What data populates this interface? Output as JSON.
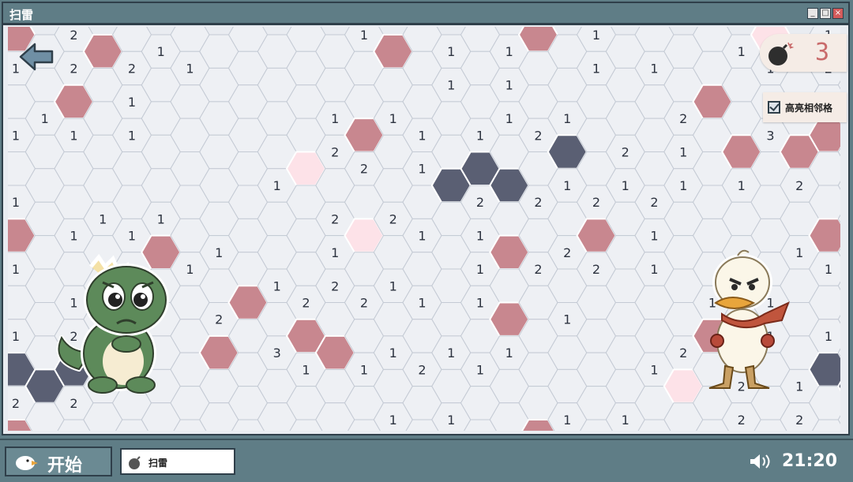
{
  "window": {
    "title": "扫雷"
  },
  "hud": {
    "mines_remaining": "3",
    "highlight_label": "高亮相邻格",
    "highlight_checked": true
  },
  "taskbar": {
    "start_label": "开始",
    "task_label": "扫雷",
    "clock": "21:20"
  },
  "icons": {
    "back": "back-arrow-icon",
    "bomb": "bomb-icon",
    "sound": "speaker-icon",
    "start": "duck-logo-icon"
  },
  "colors": {
    "hidden": "#eef0f4",
    "hidden_stroke": "#c4cad4",
    "mine": "#c8878f",
    "flag_light": "#fde2e8",
    "dark": "#5a5f73",
    "text": "#2d3340",
    "accent": "#c96b6b"
  },
  "board": {
    "rows": [
      "FN2MN1NNNNNN1MN1N1MN1NNNN1LN1N1MN2MN1NNN",
      "1N2N2N1NNNNNNNN1N1NN1N1NNN1N2N1NNN1N2N2N1NNN",
      "N1MN1NNNNNN1N1NNN1N1NNN2MN2N2N1N1MN1NNNN",
      "1N1N1NNNNNN2MN1N1N2DN2N1NM3MMN1N1N1NNNNN2M",
      "NNNNNNNNN1LN2N1DDDN1N1N1N1N2N1NNNNNNN1L",
      "1NN1N1NNNNN2N2NN2N2N2N2NNNNNN1N1NN1N1NNN2N2",
      "MN1N1MN1NNN1LN1N1MN2MN1NNNN1MN1N1MN1NN1L",
      "1NNN1N1NN1N2N1NN1N2N2N1NNNNN1N1NNN1N1NN1N2N1",
      "NN1NNNN2MN2N2N1N1MN1NNNN1N1NNNN1N1NNNNMN2",
      "1N2NNNNMN3MMN1N1N1NNNNN2MN1N1N2DN2NNNN3M",
      "DDDNNNNNNN1N1N2N1NNNNN1LN2N1DDDNNN1N1",
      "2N2NNNNNNNNNN1N1NNN1N1NNN2N2NN2N2N2N2NNN",
      "MN2NNNNNNNNN1MN1N1MN1NNN1LN1N1MN2MN1NNN",
      "1N2N2N1NNNNNN1N1NN1N1NNN1N2N1NNN1N2N2N1NNN"
    ]
  }
}
